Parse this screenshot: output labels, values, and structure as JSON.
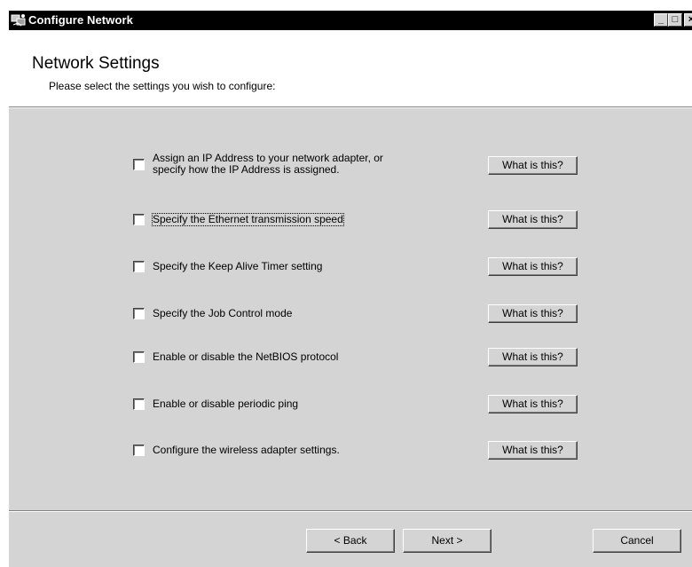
{
  "window": {
    "title": "Configure Network",
    "controls": {
      "minimize": "_",
      "maximize": "□",
      "close": "×"
    }
  },
  "header": {
    "title": "Network Settings",
    "subtitle": "Please select the settings you wish to configure:"
  },
  "options": [
    {
      "line1": "Assign an IP Address to your network adapter, or",
      "line2": "specify how the IP Address is assigned.",
      "checked": false,
      "help": "What is this?"
    },
    {
      "line1": "Specify the Ethernet transmission speed",
      "line2": "",
      "checked": false,
      "help": "What is this?"
    },
    {
      "line1": "Specify the Keep Alive Timer setting",
      "line2": "",
      "checked": false,
      "help": "What is this?"
    },
    {
      "line1": "Specify the Job Control mode",
      "line2": "",
      "checked": false,
      "help": "What is this?"
    },
    {
      "line1": "Enable or disable the NetBIOS protocol",
      "line2": "",
      "checked": false,
      "help": "What is this?"
    },
    {
      "line1": "Enable or disable periodic ping",
      "line2": "",
      "checked": false,
      "help": "What is this?"
    },
    {
      "line1": "Configure the wireless adapter settings.",
      "line2": "",
      "checked": false,
      "help": "What is this?"
    }
  ],
  "footer": {
    "back": "< Back",
    "next": "Next >",
    "cancel": "Cancel"
  }
}
